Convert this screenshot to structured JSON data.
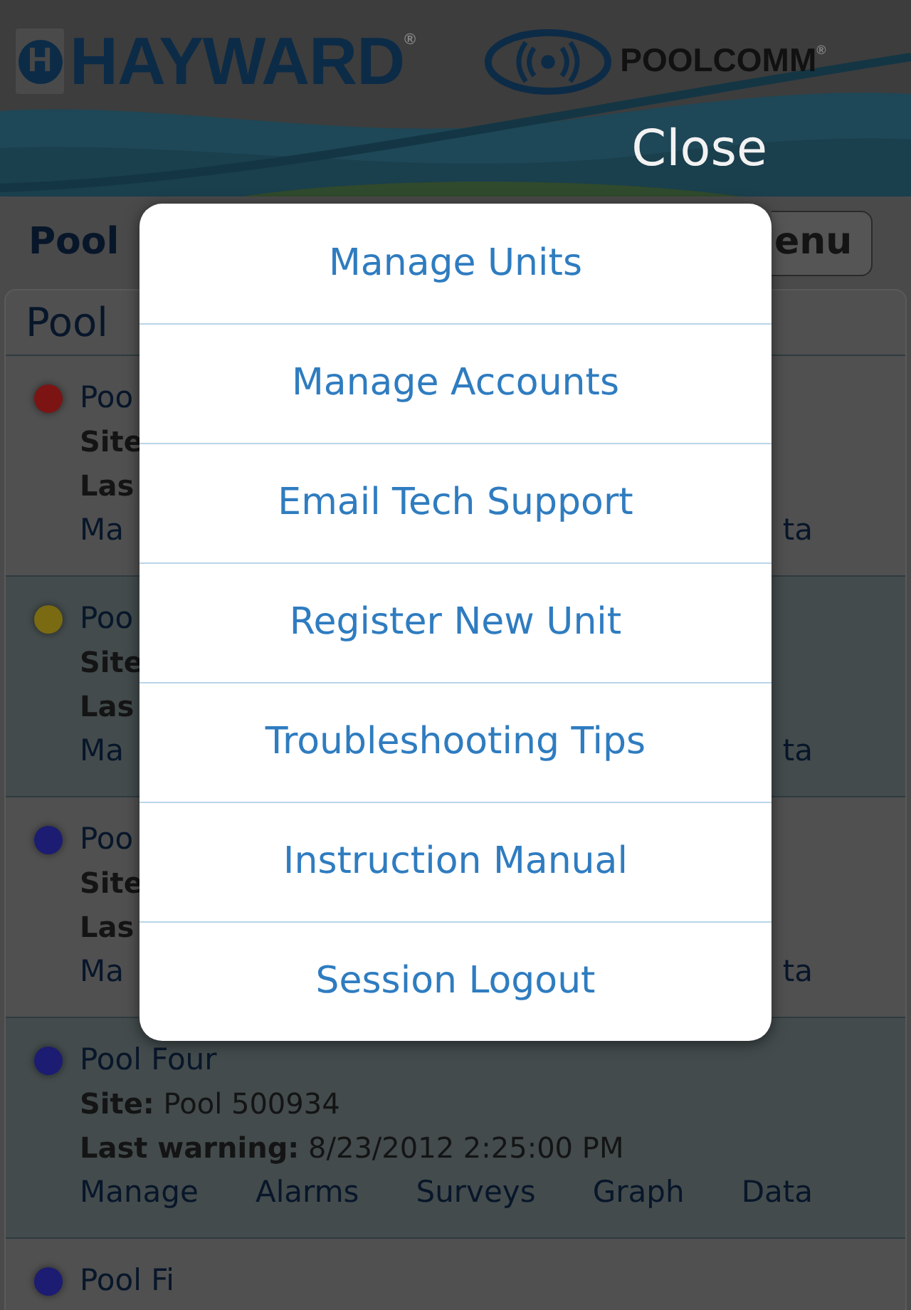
{
  "header": {
    "logo_mark": "H",
    "logo": "HAYWARD$^{®}$",
    "product": "POOLCOMM$^{®}$",
    "close": "Close"
  },
  "toolbar": {
    "title": "Pool",
    "menu_button": "enu"
  },
  "panel": {
    "heading": "Pool",
    "rows": [
      {
        "title": "Poo",
        "color": "#7c1414",
        "site_label": "Site",
        "warning_label": "Las",
        "links": [
          "Ma",
          "ta"
        ]
      },
      {
        "title": "Poo",
        "color": "#7a6a12",
        "site_label": "Site",
        "warning_label": "Las",
        "links": [
          "Ma",
          "ta"
        ]
      },
      {
        "title": "Poo",
        "color": "#1c1c72",
        "site_label": "Site",
        "warning_label": "Las",
        "links": [
          "Ma",
          "ta"
        ]
      },
      {
        "title": "Pool Four",
        "color": "#1c1c72",
        "site_label": "Site:",
        "site": "Pool 500934",
        "warning_label": "Last warning:",
        "warning": "8/23/2012 2:25:00 PM",
        "links": [
          "Manage",
          "Alarms",
          "Surveys",
          "Graph",
          "Data"
        ]
      },
      {
        "title": "Pool Fi",
        "color": "#1c1c72"
      }
    ]
  },
  "menu": {
    "items": [
      "Manage Units",
      "Manage Accounts",
      "Email Tech Support",
      "Register New Unit",
      "Troubleshooting Tips",
      "Instruction Manual",
      "Session Logout"
    ]
  }
}
